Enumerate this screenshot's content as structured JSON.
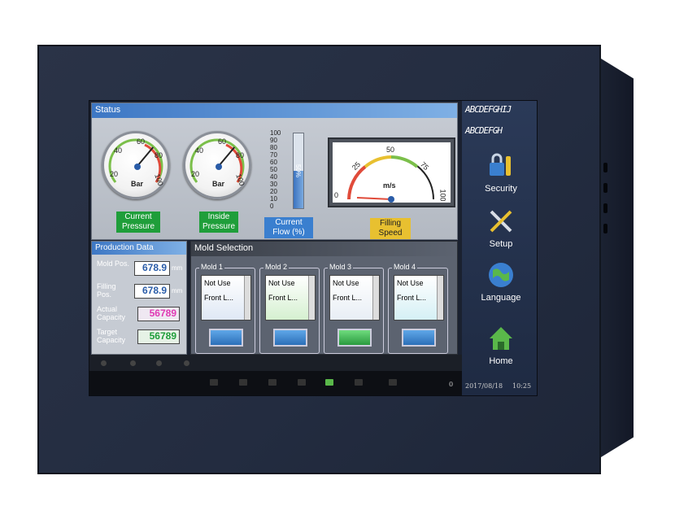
{
  "status_panel": {
    "title": "Status",
    "gauge_current_pressure": {
      "ticks": [
        "20",
        "40",
        "60",
        "80",
        "100"
      ],
      "unit": "Bar",
      "label": "Current Pressure"
    },
    "gauge_inside_pressure": {
      "ticks": [
        "20",
        "40",
        "60",
        "80",
        "100"
      ],
      "unit": "Bar",
      "label": "Inside Pressure"
    },
    "current_flow": {
      "scale": [
        "100",
        "90",
        "80",
        "70",
        "60",
        "50",
        "40",
        "30",
        "20",
        "10",
        "0"
      ],
      "value_label": "50%",
      "level": 0.5,
      "label": "Current Flow (%)"
    },
    "filling_speed": {
      "ticks": [
        "0",
        "25",
        "50",
        "75",
        "100"
      ],
      "unit": "m/s",
      "label": "Filling Speed"
    }
  },
  "sidebar": {
    "text1": "ABCDEFGHIJ",
    "text2": "ABCDEFGH",
    "buttons": [
      {
        "label": "Security",
        "icon": "lock-key-icon"
      },
      {
        "label": "Setup",
        "icon": "wrench-screwdriver-icon"
      },
      {
        "label": "Language",
        "icon": "globe-icon"
      },
      {
        "label": "Home",
        "icon": "house-icon"
      }
    ]
  },
  "production_data": {
    "title": "Production Data",
    "rows": [
      {
        "label": "Mold Pos.",
        "value": "678.9",
        "unit": "mm",
        "color": "#2a5ca8"
      },
      {
        "label": "Filling Pos.",
        "value": "678.9",
        "unit": "mm",
        "color": "#2a5ca8"
      },
      {
        "label": "Actual Capacity",
        "value": "56789",
        "color": "#e03ab4"
      },
      {
        "label": "Target Capacity",
        "value": "56789",
        "color": "#1f9e3a"
      }
    ]
  },
  "mold_selection": {
    "title": "Mold Selection",
    "molds": [
      {
        "name": "Mold 1",
        "items": [
          "Not Use",
          "Front L..."
        ],
        "bg": "#dfe8f5",
        "button": "#3a88d8"
      },
      {
        "name": "Mold 2",
        "items": [
          "Not Use",
          "Front L..."
        ],
        "bg": "#d5f0d0",
        "button": "#3a88d8"
      },
      {
        "name": "Mold 3",
        "items": [
          "Not Use",
          "Front L..."
        ],
        "bg": "#dfe8f5",
        "button": "#2fb24a"
      },
      {
        "name": "Mold 4",
        "items": [
          "Not Use",
          "Front L..."
        ],
        "bg": "#d5f0f5",
        "button": "#3a88d8"
      }
    ]
  },
  "bottom_bar": {
    "alerts": "0",
    "date": "2017/08/18",
    "time": "10:25"
  },
  "colors": {
    "accent": "#3d77c4",
    "bezel": "#232c40",
    "label_green": "#1f9e3a",
    "label_blue": "#3a7fcf",
    "label_gold": "#e8c030"
  }
}
